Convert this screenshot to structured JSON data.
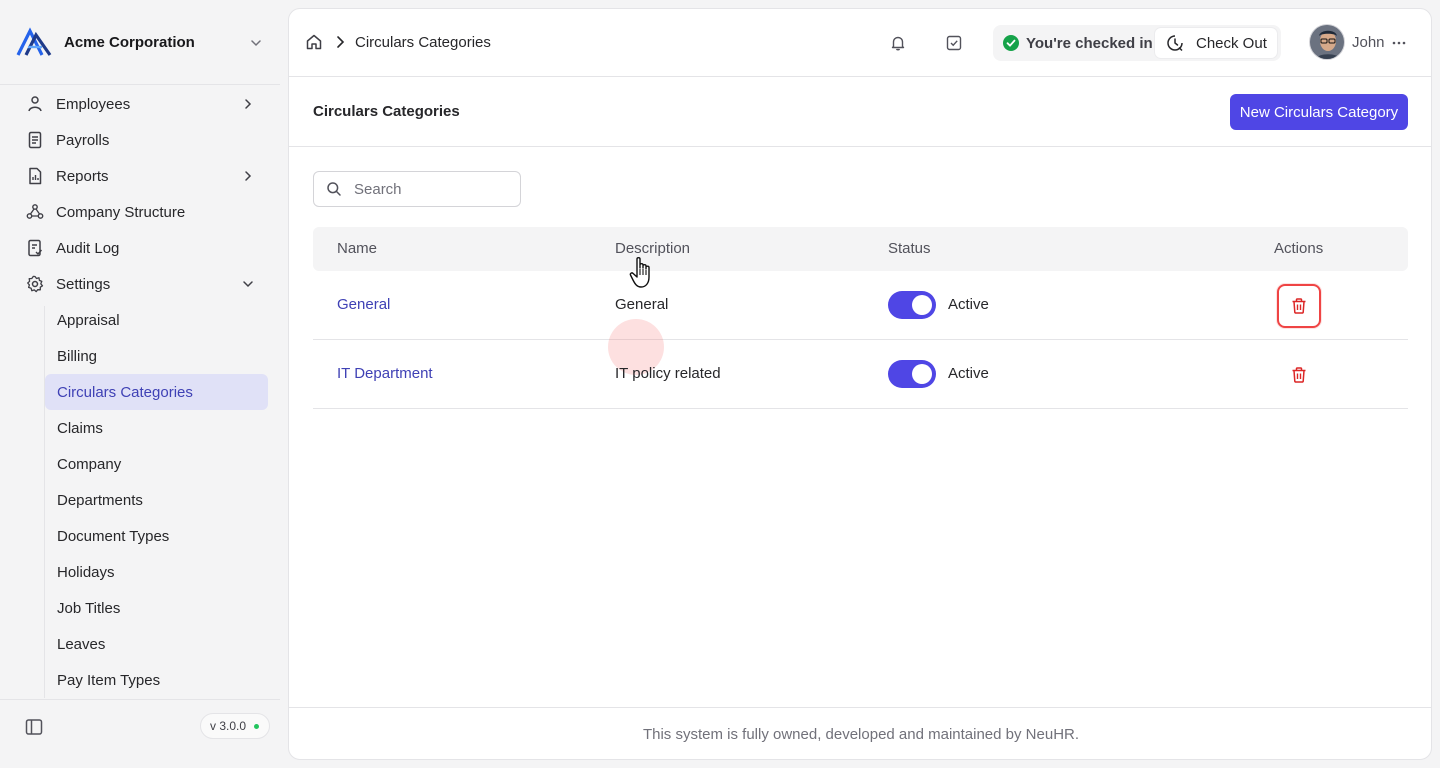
{
  "organization": {
    "name": "Acme Corporation"
  },
  "sidebar": {
    "items": [
      {
        "label": "Employees",
        "icon": "user-icon"
      },
      {
        "label": "Payrolls",
        "icon": "receipt-icon"
      },
      {
        "label": "Reports",
        "icon": "report-icon"
      },
      {
        "label": "Company Structure",
        "icon": "hierarchy-icon"
      },
      {
        "label": "Audit Log",
        "icon": "audit-icon"
      },
      {
        "label": "Settings",
        "icon": "gear-icon"
      }
    ],
    "settings_items": [
      {
        "label": "Appraisal"
      },
      {
        "label": "Billing"
      },
      {
        "label": "Circulars Categories",
        "active": true
      },
      {
        "label": "Claims"
      },
      {
        "label": "Company"
      },
      {
        "label": "Departments"
      },
      {
        "label": "Document Types"
      },
      {
        "label": "Holidays"
      },
      {
        "label": "Job Titles"
      },
      {
        "label": "Leaves"
      },
      {
        "label": "Pay Item Types"
      }
    ],
    "version": "v 3.0.0"
  },
  "header": {
    "breadcrumb": "Circulars Categories",
    "checkin_status": "You're checked in",
    "checkout_label": "Check Out",
    "user_name": "John"
  },
  "page": {
    "title": "Circulars Categories",
    "new_button_label": "New Circulars Category"
  },
  "search": {
    "placeholder": "Search",
    "value": ""
  },
  "table": {
    "headers": [
      "Name",
      "Description",
      "Status",
      "Actions"
    ],
    "rows": [
      {
        "name": "General",
        "description": "General",
        "status": "Active",
        "enabled": true
      },
      {
        "name": "IT Department",
        "description": "IT policy related",
        "status": "Active",
        "enabled": true
      }
    ]
  },
  "footer": {
    "text": "This system is fully owned, developed and maintained by NeuHR."
  },
  "colors": {
    "accent": "#4f46e5",
    "link": "#3f41b5",
    "active_bg": "#e0e1f7",
    "danger": "#ef4444",
    "success": "#16a34a"
  }
}
